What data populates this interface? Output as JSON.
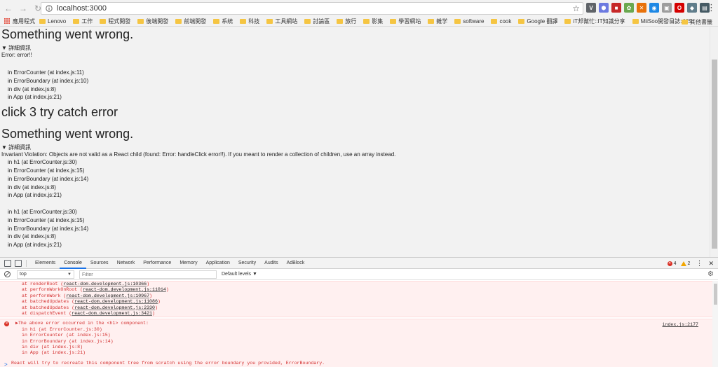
{
  "browser": {
    "url": "localhost:3000",
    "extensions": [
      {
        "icon": "extension-v-icon",
        "color": "#5f6368",
        "glyph": "V"
      },
      {
        "icon": "extension-hex-icon",
        "color": "#6c7ae0",
        "glyph": "⬢"
      },
      {
        "icon": "extension-red-icon",
        "color": "#c62828",
        "glyph": "■"
      },
      {
        "icon": "extension-leaf-icon",
        "color": "#6aa84f",
        "glyph": "✿"
      },
      {
        "icon": "extension-orange-icon",
        "color": "#e8710a",
        "glyph": "✕"
      },
      {
        "icon": "extension-blue-icon",
        "color": "#1e88e5",
        "glyph": "◉"
      },
      {
        "icon": "extension-grey-icon",
        "color": "#9e9e9e",
        "glyph": "▣"
      },
      {
        "icon": "extension-opera-icon",
        "color": "#d50000",
        "glyph": "O"
      },
      {
        "icon": "extension-shield-icon",
        "color": "#607d8b",
        "glyph": "◆"
      },
      {
        "icon": "extension-g-icon",
        "color": "#455a64",
        "glyph": "▤"
      }
    ]
  },
  "bookmarks": {
    "apps": "應用程式",
    "items": [
      "Lenovo",
      "工作",
      "程式開發",
      "後端開發",
      "前端開發",
      "系統",
      "科技",
      "工具網站",
      "討論區",
      "旅行",
      "影集",
      "學習網站",
      "雜学",
      "software",
      "cook",
      "Google 翻譯",
      "iT邦幫忙::IT知識分享",
      "MiiSoo開發日誌: MS"
    ],
    "overflow": "»",
    "other": "其他書籤"
  },
  "page": {
    "block1": {
      "title": "Something went wrong.",
      "details": "▼ 詳細資訊",
      "message": "Error: error!!",
      "stack": [
        "in ErrorCounter (at index.js:11)",
        "in ErrorBoundary (at index.js:10)",
        "in div (at index.js:8)",
        "in App (at index.js:21)"
      ]
    },
    "heading": "click 3 try catch error",
    "block2": {
      "title": "Something went wrong.",
      "details": "▼ 詳細資訊",
      "message": "Invariant Violation: Objects are not valid as a React child (found: Error: handleClick error!!). If you meant to render a collection of children, use an array instead.",
      "stack1": [
        "in h1 (at ErrorCounter.js:30)",
        "in ErrorCounter (at index.js:15)",
        "in ErrorBoundary (at index.js:14)",
        "in div (at index.js:8)",
        "in App (at index.js:21)"
      ],
      "stack2": [
        "in h1 (at ErrorCounter.js:30)",
        "in ErrorCounter (at index.js:15)",
        "in ErrorBoundary (at index.js:14)",
        "in div (at index.js:8)",
        "in App (at index.js:21)"
      ]
    }
  },
  "devtools": {
    "tabs": [
      "Elements",
      "Console",
      "Sources",
      "Network",
      "Performance",
      "Memory",
      "Application",
      "Security",
      "Audits",
      "AdBlock"
    ],
    "active_tab": "Console",
    "error_count": "4",
    "warning_count": "2",
    "context": "top",
    "filter_placeholder": "Filter",
    "levels": "Default levels ▼",
    "trace": [
      {
        "fn": "at renderRoot",
        "src": "react-dom.development.js:10366"
      },
      {
        "fn": "at performWorkOnRoot",
        "src": "react-dom.development.js:11014"
      },
      {
        "fn": "at performWork",
        "src": "react-dom.development.js:10967"
      },
      {
        "fn": "at batchedUpdates",
        "src": "react-dom.development.js:11086"
      },
      {
        "fn": "at batchedUpdates",
        "src": "react-dom.development.js:2330"
      },
      {
        "fn": "at dispatchEvent",
        "src": "react-dom.development.js:3421"
      }
    ],
    "error2": {
      "head": "▶The above error occurred in the <h1> component:",
      "source": "index.js:2177",
      "lines": [
        "in h1 (at ErrorCounter.js:30)",
        "in ErrorCounter (at index.js:15)",
        "in ErrorBoundary (at index.js:14)",
        "in div (at index.js:8)",
        "in App (at index.js:21)"
      ],
      "note": "React will try to recreate this component tree from scratch using the error boundary you provided, ErrorBoundary."
    },
    "prompt": ">"
  }
}
